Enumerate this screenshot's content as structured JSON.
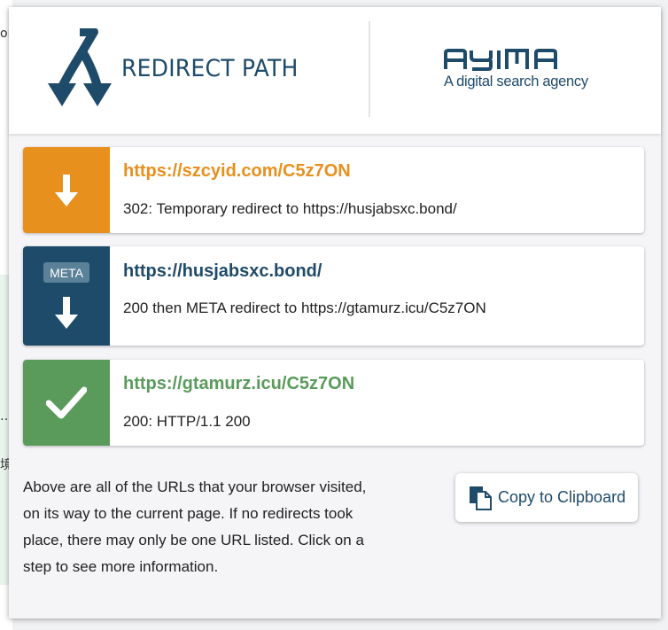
{
  "background": {
    "fragment_top": "or",
    "fragment_mid": "…",
    "fragment_low": "境"
  },
  "header": {
    "brand_name": "REDIRECT PATH",
    "partner_name": "AYIMA",
    "partner_tagline": "A digital search agency"
  },
  "steps": [
    {
      "url": "https://szcyid.com/C5z7ON",
      "description": "302: Temporary redirect to https://husjabsxc.bond/",
      "icon": "arrow-down-icon",
      "color": "#e8901e"
    },
    {
      "badge": "META",
      "url": "https://husjabsxc.bond/",
      "description": "200 then META redirect to https://gtamurz.icu/C5z7ON",
      "icon": "arrow-down-icon",
      "color": "#1f4b6a"
    },
    {
      "url": "https://gtamurz.icu/C5z7ON",
      "description": "200: HTTP/1.1 200",
      "icon": "checkmark-icon",
      "color": "#5a9b5c"
    }
  ],
  "footer": {
    "info_text": "Above are all of the URLs that your browser visited, on its way to the current page. If no redirects took place, there may only be one URL listed. Click on a step to see more information.",
    "copy_label": "Copy to Clipboard"
  }
}
